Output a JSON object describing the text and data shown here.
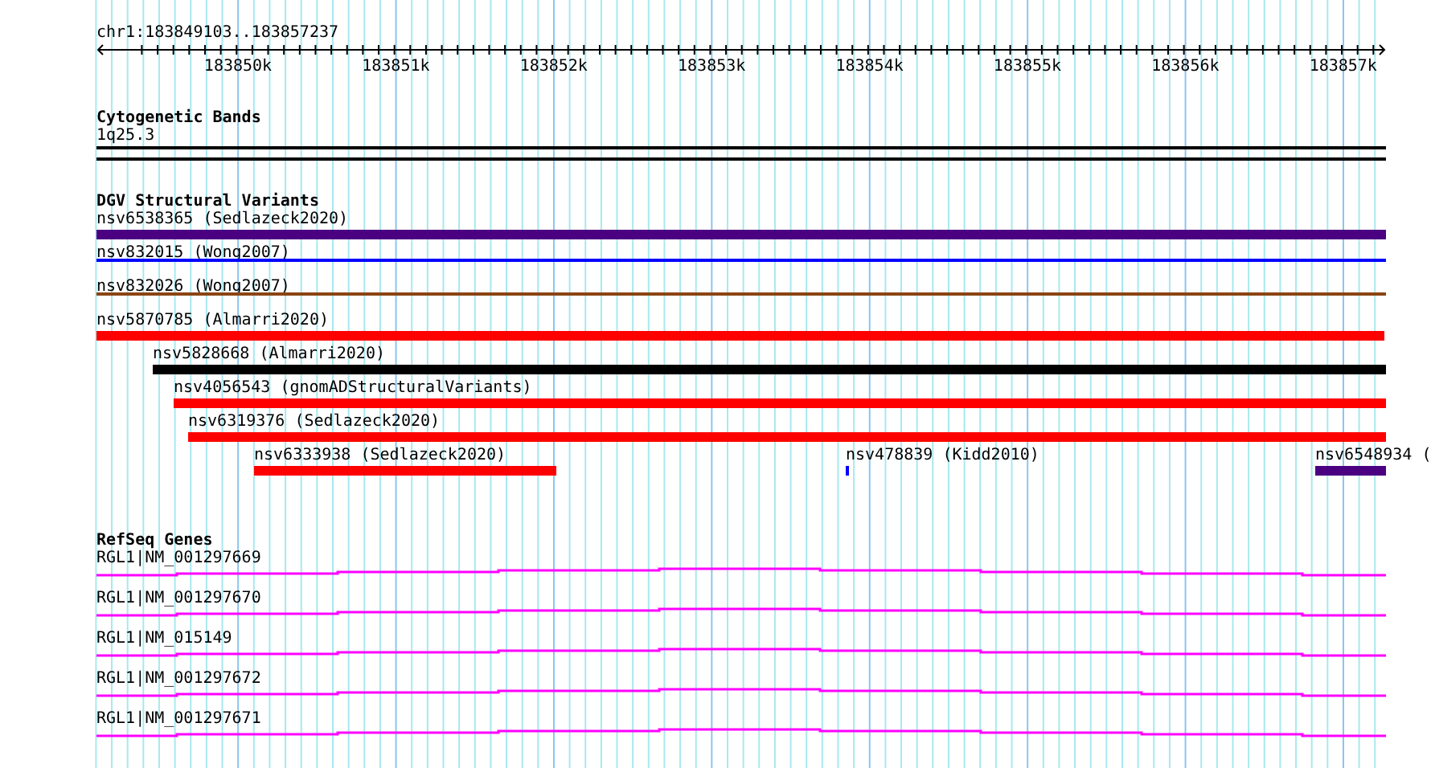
{
  "ruler": {
    "location": "chr1:183849103..183857237",
    "ticks": [
      "183850k",
      "183851k",
      "183852k",
      "183853k",
      "183854k",
      "183855k",
      "183856k",
      "183857k"
    ]
  },
  "cytobands": {
    "title": "Cytogenetic Bands",
    "band": "1q25.3"
  },
  "variants": {
    "title": "DGV Structural Variants",
    "rows": [
      {
        "features": [
          {
            "label": "nsv6538365 (Sedlazeck2020)",
            "color": "#4b0082",
            "kind": "bar"
          }
        ]
      },
      {
        "features": [
          {
            "label": "nsv832015 (Wong2007)",
            "color": "#0000ff",
            "kind": "line"
          }
        ]
      },
      {
        "features": [
          {
            "label": "nsv832026 (Wong2007)",
            "color": "#8b4513",
            "kind": "line"
          }
        ]
      },
      {
        "features": [
          {
            "label": "nsv5870785 (Almarri2020)",
            "color": "#ff0000",
            "kind": "bar"
          }
        ]
      },
      {
        "features": [
          {
            "label": "nsv5828668 (Almarri2020)",
            "color": "#000000",
            "kind": "bar"
          }
        ]
      },
      {
        "features": [
          {
            "label": "nsv4056543 (gnomADStructuralVariants)",
            "color": "#ff0000",
            "kind": "bar"
          }
        ]
      },
      {
        "features": [
          {
            "label": "nsv6319376 (Sedlazeck2020)",
            "color": "#ff0000",
            "kind": "bar"
          }
        ]
      },
      {
        "features": [
          {
            "label": "nsv6333938 (Sedlazeck2020)",
            "color": "#ff0000",
            "kind": "bar"
          },
          {
            "label": "nsv478839 (Kidd2010)",
            "color": "#0000ff",
            "kind": "bar"
          },
          {
            "label": "nsv6548934 (",
            "color": "#4b0082",
            "kind": "bar"
          }
        ]
      }
    ]
  },
  "genes": {
    "title": "RefSeq Genes",
    "transcripts": [
      "RGL1|NM_001297669",
      "RGL1|NM_001297670",
      "RGL1|NM_015149",
      "RGL1|NM_001297672",
      "RGL1|NM_001297671"
    ]
  }
}
